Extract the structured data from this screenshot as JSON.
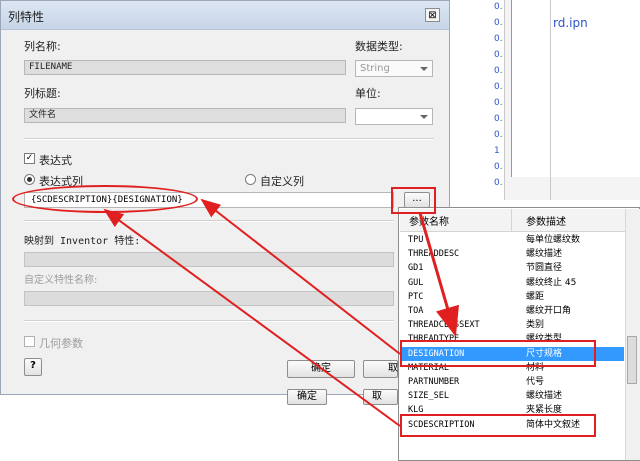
{
  "background": {
    "file_name": "rd.ipn",
    "cells": [
      "0.",
      "0.",
      "0.",
      "0.",
      "0.",
      "0.",
      "0.",
      "0.",
      "0.",
      "1",
      "0.",
      "0."
    ]
  },
  "dialog": {
    "title": "列特性",
    "close_label": "⊠",
    "column_name_label": "列名称:",
    "column_name_value": "FILENAME",
    "data_type_label": "数据类型:",
    "data_type_value": "String",
    "column_title_label": "列标题:",
    "column_title_value": "文件名",
    "unit_label": "单位:",
    "expression_checkbox_label": "表达式",
    "expression_checked": true,
    "radio_expression_column_label": "表达式列",
    "radio_custom_column_label": "自定义列",
    "expression_value": "{SCDESCRIPTION}{DESIGNATION}",
    "expression_browse_label": "...",
    "map_inventor_label": "映射到 Inventor 特性:",
    "custom_property_label": "自定义特性名称:",
    "geometry_param_label": "几何参数",
    "ok_label": "确定",
    "cancel_label": "取",
    "ok_label_2": "确定",
    "cancel_label_2": "取",
    "help_icon": "?"
  },
  "popup": {
    "header_name": "参数名称",
    "header_desc": "参数描述",
    "rows": [
      {
        "name": "TPU",
        "desc": "每单位螺纹数"
      },
      {
        "name": "THREADDESC",
        "desc": "螺纹描述"
      },
      {
        "name": "GD1",
        "desc": "节圆直径"
      },
      {
        "name": "GUL",
        "desc": "螺纹终止 45"
      },
      {
        "name": "PTC",
        "desc": "螺距"
      },
      {
        "name": "TOA",
        "desc": "螺纹开口角"
      },
      {
        "name": "THREADCLASSEXT",
        "desc": "类别"
      },
      {
        "name": "THREADTYPE",
        "desc": "螺纹类型"
      },
      {
        "name": "DESIGNATION",
        "desc": "尺寸规格",
        "selected": true
      },
      {
        "name": "MATERIAL",
        "desc": "材料"
      },
      {
        "name": "PARTNUMBER",
        "desc": "代号"
      },
      {
        "name": "SIZE_SEL",
        "desc": "螺纹描述"
      },
      {
        "name": "KLG",
        "desc": "夹紧长度"
      },
      {
        "name": "SCDESCRIPTION",
        "desc": "简体中文叙述"
      }
    ]
  },
  "colors": {
    "annotation_red": "#e02020",
    "selection_blue": "#3399ff",
    "link_blue": "#2c57c8"
  }
}
